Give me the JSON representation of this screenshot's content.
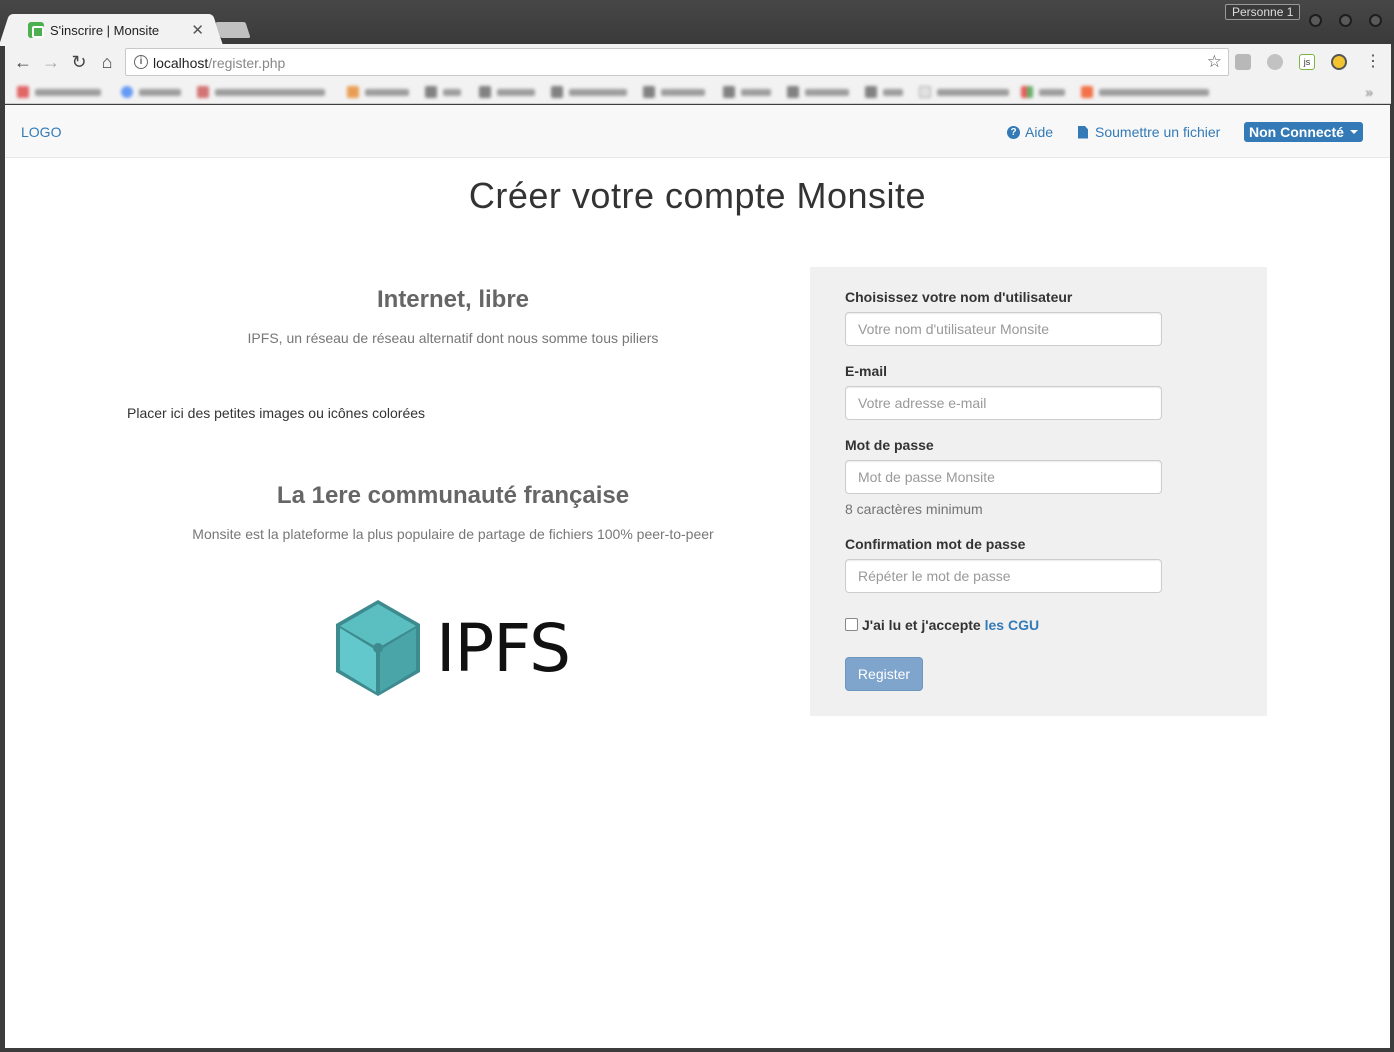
{
  "browser": {
    "tab_title": "S'inscrire | Monsite",
    "profile_label": "Personne 1",
    "url_host": "localhost",
    "url_path": "/register.php"
  },
  "navbar": {
    "logo": "LOGO",
    "help_label": "Aide",
    "submit_label": "Soumettre un fichier",
    "account_label": "Non Connecté"
  },
  "main": {
    "title": "Créer votre compte Monsite",
    "features": [
      {
        "heading": "Internet, libre",
        "text": "IPFS, un réseau de réseau alternatif dont nous somme tous piliers"
      },
      {
        "heading": "La 1ere communauté française",
        "text": "Monsite est la plateforme la plus populaire de partage de fichiers 100% peer-to-peer"
      }
    ],
    "icons_placeholder": "Placer ici des petites images ou icônes colorées",
    "logo_text": "IPFS"
  },
  "form": {
    "username_label": "Choisissez votre nom d'utilisateur",
    "username_placeholder": "Votre nom d'utilisateur Monsite",
    "email_label": "E-mail",
    "email_placeholder": "Votre adresse e-mail",
    "password_label": "Mot de passe",
    "password_placeholder": "Mot de passe Monsite",
    "password_help": "8 caractères minimum",
    "confirm_label": "Confirmation mot de passe",
    "confirm_placeholder": "Répéter le mot de passe",
    "terms_label": "J'ai lu et j'accepte",
    "terms_link": "les CGU",
    "submit_label": "Register"
  },
  "colors": {
    "link": "#337ab7",
    "panel_bg": "#f0f0f0",
    "button_bg": "#7fa5cd",
    "ipfs_teal": "#4aa5a8"
  }
}
